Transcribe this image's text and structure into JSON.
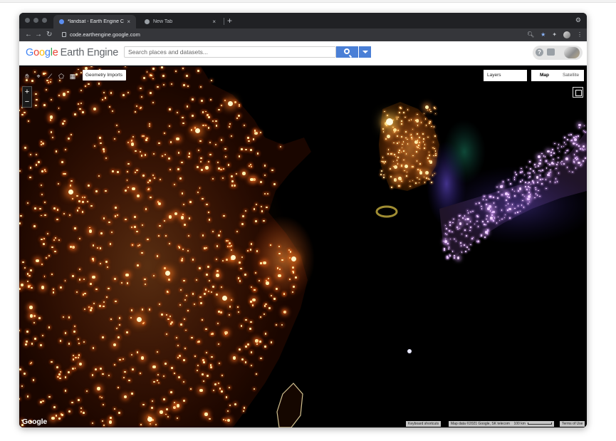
{
  "browser": {
    "tabs": [
      {
        "title": "*landsat - Earth Engine Code",
        "close": "×"
      },
      {
        "title": "New Tab",
        "close": "×"
      }
    ],
    "new_tab": "+",
    "url": "code.earthengine.google.com",
    "nav": {
      "back": "←",
      "forward": "→",
      "reload": "↻"
    }
  },
  "header": {
    "logo_google": [
      "G",
      "o",
      "o",
      "g",
      "l",
      "e"
    ],
    "logo_product": "Earth Engine",
    "search_placeholder": "Search places and datasets...",
    "help": "?"
  },
  "map": {
    "geometry_imports": "Geometry Imports",
    "layers": "Layers",
    "map_types": [
      "Map",
      "Satellite"
    ],
    "selected_map_type": "Map",
    "zoom_in": "+",
    "zoom_out": "−",
    "google_mark": "Google",
    "keyboard_shortcuts": "Keyboard shortcuts",
    "map_data": "Map data ©2021 Google, SK telecom",
    "scale": "100 km",
    "terms": "Terms of Use"
  },
  "colors": {
    "chrome_dark": "#202124",
    "chrome_mid": "#35363a",
    "search_blue": "#4a7fd6",
    "city_light_core": "#fff2b0",
    "city_light_glow": "#ff6a1a",
    "japan_light": "#f2d6ff"
  }
}
